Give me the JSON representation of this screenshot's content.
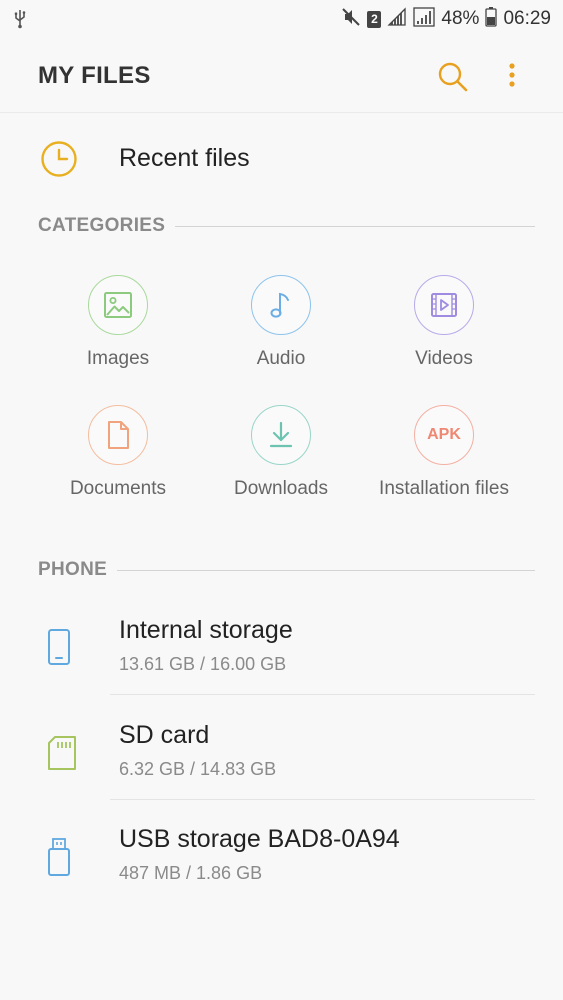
{
  "status_bar": {
    "battery": "48%",
    "time": "06:29",
    "sim_slot": "2"
  },
  "app_bar": {
    "title": "MY FILES",
    "search_icon": "search-icon",
    "more_icon": "more-vertical-icon"
  },
  "recent": {
    "label": "Recent files",
    "icon": "clock-icon"
  },
  "categories": {
    "header": "CATEGORIES",
    "items": [
      {
        "label": "Images",
        "icon": "image-icon",
        "color": "#8cca7d"
      },
      {
        "label": "Audio",
        "icon": "music-note-icon",
        "color": "#6aaee5"
      },
      {
        "label": "Videos",
        "icon": "video-icon",
        "color": "#9f8ce0"
      },
      {
        "label": "Documents",
        "icon": "document-icon",
        "color": "#f0a37c"
      },
      {
        "label": "Downloads",
        "icon": "download-icon",
        "color": "#6cc3b0"
      },
      {
        "label": "Installation files",
        "icon": "apk-icon",
        "apk_text": "APK",
        "color": "#ef8873"
      }
    ]
  },
  "phone": {
    "header": "PHONE",
    "items": [
      {
        "name": "Internal storage",
        "size": "13.61 GB / 16.00 GB",
        "icon": "phone-icon",
        "color": "#5fa9e0"
      },
      {
        "name": "SD card",
        "size": "6.32 GB / 14.83 GB",
        "icon": "sd-card-icon",
        "color": "#a6c55f"
      },
      {
        "name": "USB storage BAD8-0A94",
        "size": "487 MB / 1.86 GB",
        "icon": "usb-drive-icon",
        "color": "#5fa9e0"
      }
    ]
  },
  "colors": {
    "accent": "#e8a020",
    "background": "#f8f8f8",
    "section_header": "#8a8a8a"
  }
}
